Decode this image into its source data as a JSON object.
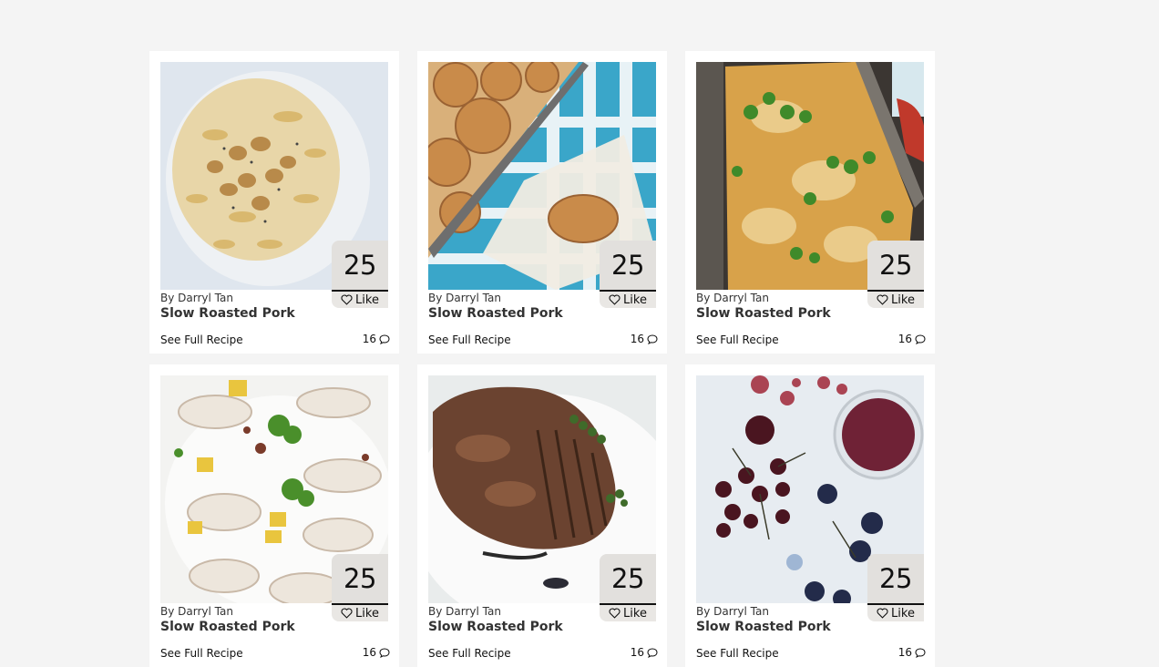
{
  "cards": [
    {
      "likes": "25",
      "like_label": "Like",
      "author": "By Darryl Tan",
      "title": "Slow Roasted Pork",
      "link": "See Full Recipe",
      "comments": "16",
      "image": "pasta-with-pecans"
    },
    {
      "likes": "25",
      "like_label": "Like",
      "author": "By Darryl Tan",
      "title": "Slow Roasted Pork",
      "link": "See Full Recipe",
      "comments": "16",
      "image": "cinnamon-rolls"
    },
    {
      "likes": "25",
      "like_label": "Like",
      "author": "By Darryl Tan",
      "title": "Slow Roasted Pork",
      "link": "See Full Recipe",
      "comments": "16",
      "image": "baked-casserole-with-cilantro"
    },
    {
      "likes": "25",
      "like_label": "Like",
      "author": "By Darryl Tan",
      "title": "Slow Roasted Pork",
      "link": "See Full Recipe",
      "comments": "16",
      "image": "grilled-squid-salad"
    },
    {
      "likes": "25",
      "like_label": "Like",
      "author": "By Darryl Tan",
      "title": "Slow Roasted Pork",
      "link": "See Full Recipe",
      "comments": "16",
      "image": "sliced-roast-pork"
    },
    {
      "likes": "25",
      "like_label": "Like",
      "author": "By Darryl Tan",
      "title": "Slow Roasted Pork",
      "link": "See Full Recipe",
      "comments": "16",
      "image": "cherries-and-smoothie"
    }
  ],
  "icons": {
    "like": "heart-icon",
    "comments": "speech-bubble-icon"
  },
  "colors": {
    "page_bg": "#f4f4f4",
    "card_bg": "#ffffff",
    "badge_bg": "#e2e0dd",
    "text": "#333333"
  }
}
